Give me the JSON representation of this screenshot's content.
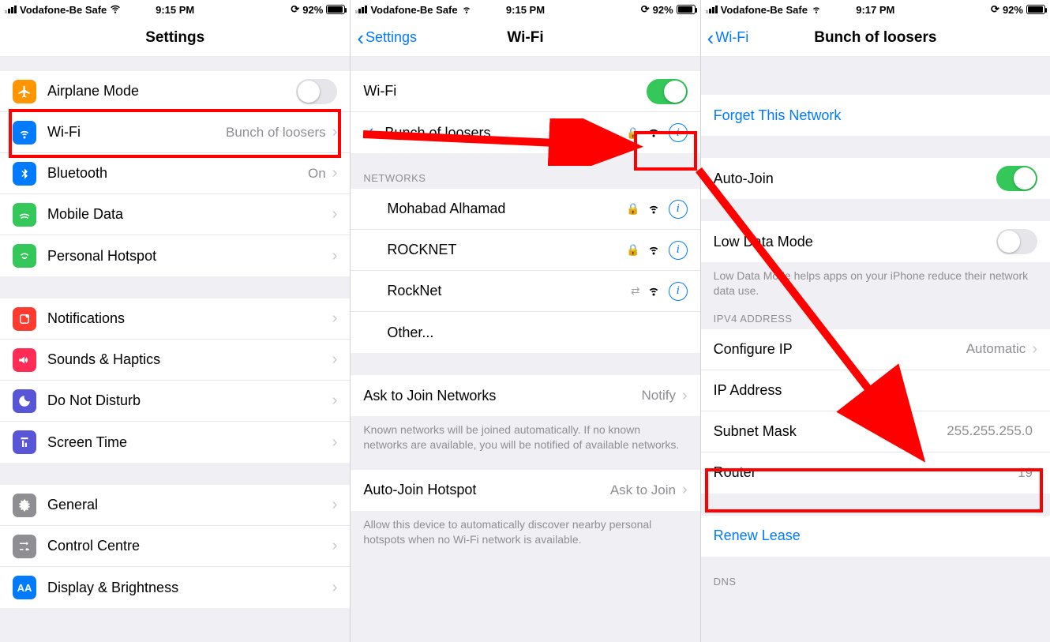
{
  "statusbar": {
    "carrier": "Vodafone-Be Safe",
    "time1": "9:15 PM",
    "time3": "9:17 PM",
    "battery": "92%"
  },
  "panel1": {
    "title": "Settings",
    "rows": {
      "airplane": "Airplane Mode",
      "wifi": "Wi-Fi",
      "wifi_value": "Bunch of loosers",
      "bluetooth": "Bluetooth",
      "bluetooth_value": "On",
      "mobiledata": "Mobile Data",
      "hotspot": "Personal Hotspot",
      "notifications": "Notifications",
      "sounds": "Sounds & Haptics",
      "dnd": "Do Not Disturb",
      "screentime": "Screen Time",
      "general": "General",
      "controlcentre": "Control Centre",
      "display": "Display & Brightness"
    }
  },
  "panel2": {
    "back": "Settings",
    "title": "Wi-Fi",
    "wifi_label": "Wi-Fi",
    "connected": "Bunch of loosers",
    "networks_header": "NETWORKS",
    "networks": {
      "n1": "Mohabad Alhamad",
      "n2": "ROCKNET",
      "n3": "RockNet",
      "other": "Other..."
    },
    "ask_label": "Ask to Join Networks",
    "ask_value": "Notify",
    "ask_footer": "Known networks will be joined automatically. If no known networks are available, you will be notified of available networks.",
    "autojoin_label": "Auto-Join Hotspot",
    "autojoin_value": "Ask to Join",
    "autojoin_footer": "Allow this device to automatically discover nearby personal hotspots when no Wi-Fi network is available."
  },
  "panel3": {
    "back": "Wi-Fi",
    "title": "Bunch of loosers",
    "forget": "Forget This Network",
    "autojoin": "Auto-Join",
    "lowdata": "Low Data Mode",
    "lowdata_footer": "Low Data Mode helps apps on your iPhone reduce their network data use.",
    "ipv4_header": "IPV4 ADDRESS",
    "configip": "Configure IP",
    "configip_value": "Automatic",
    "ipaddress": "IP Address",
    "subnet": "Subnet Mask",
    "subnet_value": "255.255.255.0",
    "router": "Router",
    "router_value": "19",
    "renew": "Renew Lease",
    "dns_header": "DNS"
  }
}
